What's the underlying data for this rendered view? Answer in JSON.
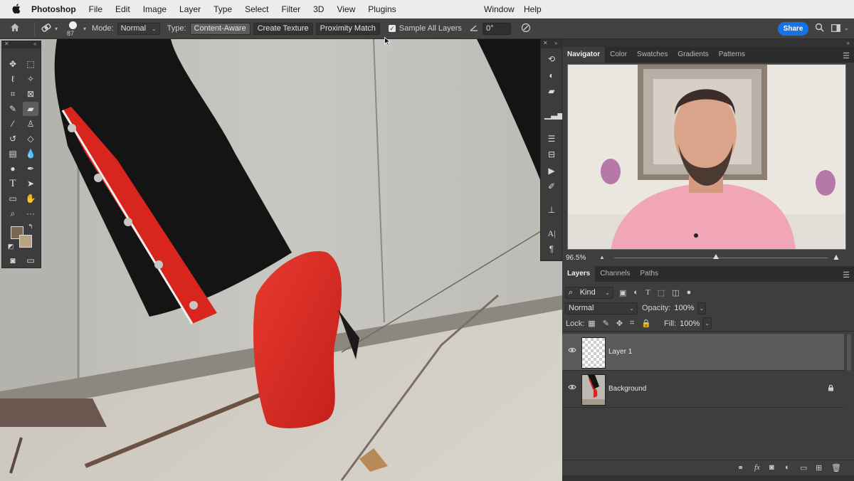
{
  "menubar": {
    "apple": "",
    "app_name": "Photoshop",
    "items": [
      "File",
      "Edit",
      "Image",
      "Layer",
      "Type",
      "Select",
      "Filter",
      "3D",
      "View",
      "Plugins"
    ],
    "right_items": [
      "Window",
      "Help"
    ]
  },
  "options": {
    "brush_size": "87",
    "mode_label": "Mode:",
    "mode_value": "Normal",
    "type_label": "Type:",
    "type_options": [
      "Content-Aware",
      "Create Texture",
      "Proximity Match"
    ],
    "sample_all_layers_label": "Sample All Layers",
    "sample_all_layers_checked": true,
    "angle_value": "0°",
    "share_label": "Share"
  },
  "tools": {
    "icons": [
      "move-icon",
      "marquee-icon",
      "lasso-icon",
      "magic-wand-icon",
      "crop-icon",
      "frame-icon",
      "eyedropper-icon",
      "spot-healing-brush-icon",
      "brush-icon",
      "clone-stamp-icon",
      "history-brush-icon",
      "eraser-icon",
      "gradient-icon",
      "blur-icon",
      "dodge-icon",
      "pen-icon",
      "type-icon",
      "path-selection-icon",
      "rectangle-icon",
      "hand-icon",
      "zoom-icon",
      "more-tools-icon"
    ],
    "foreground_color": "#7a6651",
    "background_color": "#b7a486"
  },
  "navigator": {
    "tabs": [
      "Navigator",
      "Color",
      "Swatches",
      "Gradients",
      "Patterns"
    ],
    "active_tab": "Navigator",
    "zoom": "96.5%"
  },
  "layers": {
    "tabs": [
      "Layers",
      "Channels",
      "Paths"
    ],
    "active_tab": "Layers",
    "filter_kind": "Kind",
    "blend_mode": "Normal",
    "opacity_label": "Opacity:",
    "opacity_value": "100%",
    "lock_label": "Lock:",
    "fill_label": "Fill:",
    "fill_value": "100%",
    "items": [
      {
        "name": "Layer 1",
        "visible": true,
        "selected": true,
        "locked": false
      },
      {
        "name": "Background",
        "visible": true,
        "selected": false,
        "locked": true
      }
    ],
    "bottom_icons": [
      "link-icon",
      "fx-icon",
      "mask-icon",
      "adjustment-icon",
      "group-icon",
      "new-layer-icon",
      "delete-icon"
    ],
    "fx_label": "fx"
  },
  "colors": {
    "accent": "#1473e6",
    "panel_bg": "#3e3e3e",
    "selected_layer": "#5a5a5a"
  }
}
